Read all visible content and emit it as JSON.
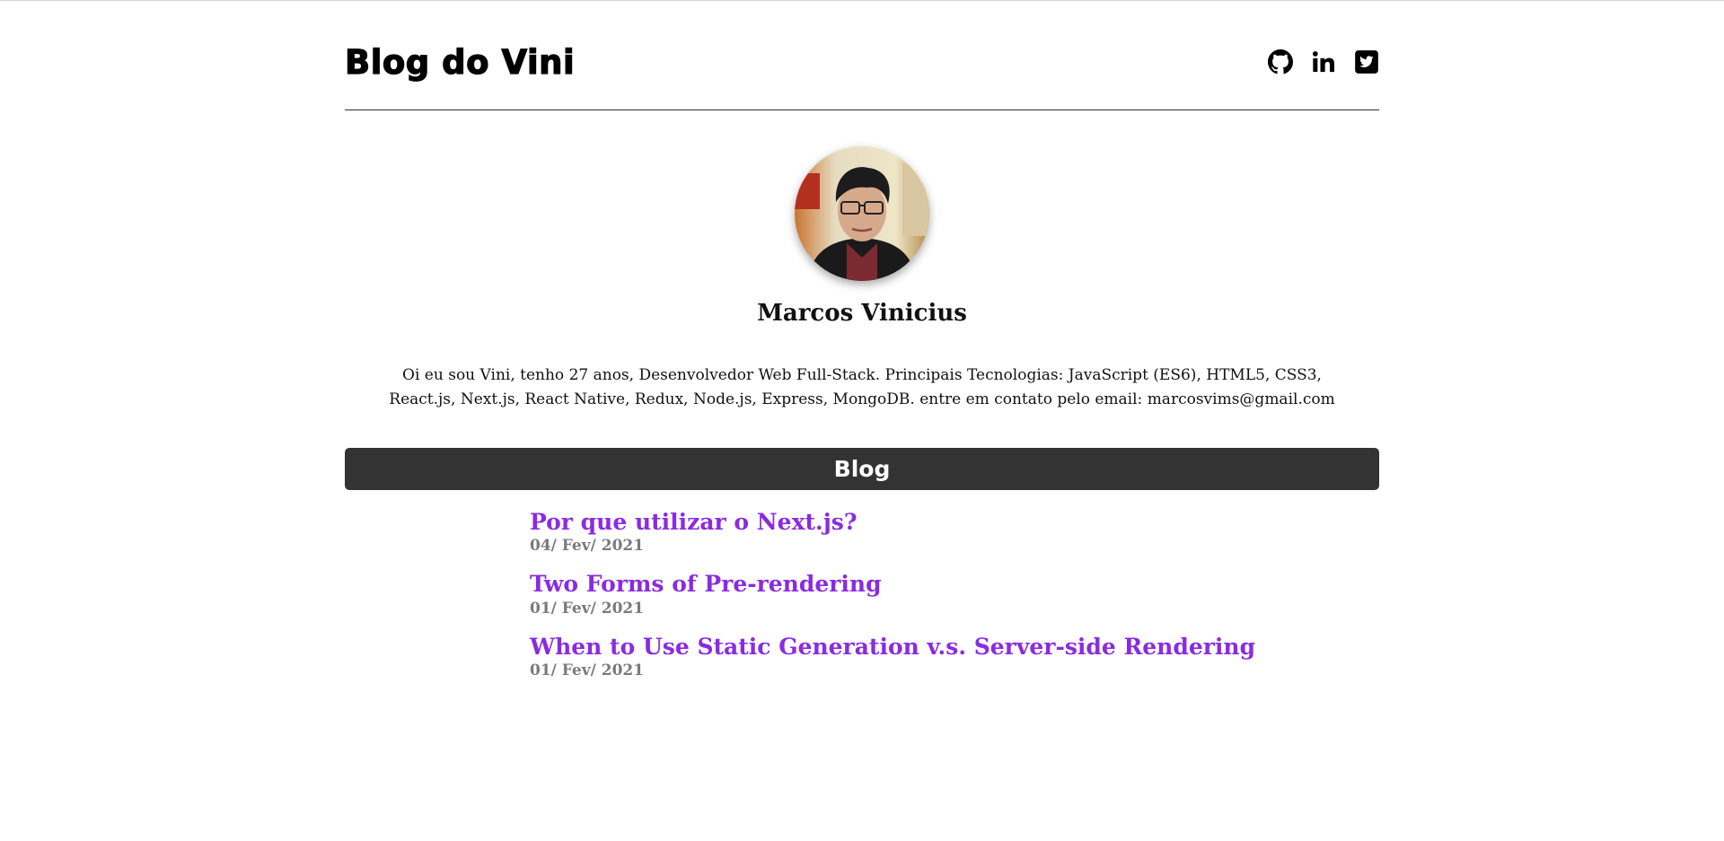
{
  "header": {
    "title": "Blog do Vini",
    "socials": [
      {
        "icon": "github-icon"
      },
      {
        "icon": "linkedin-icon"
      },
      {
        "icon": "twitter-icon"
      }
    ]
  },
  "profile": {
    "name": "Marcos Vinicius",
    "bio": "Oi eu sou Vini, tenho 27 anos, Desenvolvedor Web Full-Stack. Principais Tecnologias: JavaScript (ES6), HTML5, CSS3, React.js, Next.js, React Native, Redux, Node.js, Express, MongoDB. entre em contato pelo email: marcosvims@gmail.com"
  },
  "blog": {
    "heading": "Blog",
    "posts": [
      {
        "title": "Por que utilizar o Next.js?",
        "date": "04/ Fev/ 2021"
      },
      {
        "title": "Two Forms of Pre-rendering",
        "date": "01/ Fev/ 2021"
      },
      {
        "title": "When to Use Static Generation v.s. Server-side Rendering",
        "date": "01/ Fev/ 2021"
      }
    ]
  },
  "colors": {
    "link": "#8a2be2",
    "date": "#7a7a7a",
    "section_bar": "#333333"
  }
}
